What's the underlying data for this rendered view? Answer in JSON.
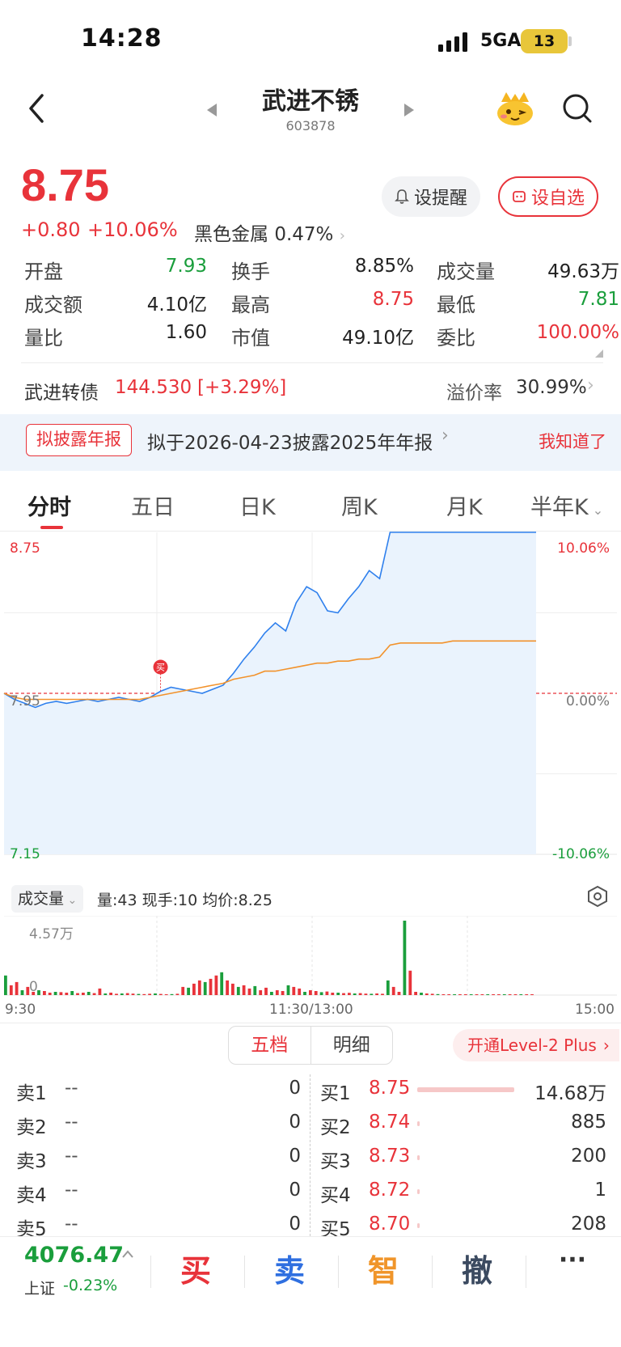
{
  "status": {
    "time": "14:28",
    "network": "5GA",
    "battery": "13"
  },
  "nav": {
    "title": "武进不锈",
    "code": "603878"
  },
  "quote": {
    "price": "8.75",
    "change": "+0.80",
    "change_pct": "+10.06%",
    "sector": "黑色金属",
    "sector_pct": "0.47%",
    "alert_label": "设提醒",
    "watch_label": "设自选"
  },
  "stats": [
    {
      "label": "开盘",
      "value": "7.93",
      "color": "green"
    },
    {
      "label": "换手",
      "value": "8.85%",
      "color": "black"
    },
    {
      "label": "成交量",
      "value": "49.63万",
      "color": "black"
    },
    {
      "label": "成交额",
      "value": "4.10亿",
      "color": "black"
    },
    {
      "label": "最高",
      "value": "8.75",
      "color": "red"
    },
    {
      "label": "最低",
      "value": "7.81",
      "color": "green"
    },
    {
      "label": "量比",
      "value": "1.60",
      "color": "black"
    },
    {
      "label": "市值",
      "value": "49.10亿",
      "color": "black"
    },
    {
      "label": "委比",
      "value": "100.00%",
      "color": "red"
    }
  ],
  "bond": {
    "label": "武进转债",
    "price": "144.530",
    "change_pct": "[+3.29%]",
    "premium_label": "溢价率",
    "premium_value": "30.99%"
  },
  "notice": {
    "tag": "拟披露年报",
    "text": "拟于2026-04-23披露2025年年报",
    "dismiss": "我知道了"
  },
  "tabs": [
    "分时",
    "五日",
    "日K",
    "周K",
    "月K",
    "半年K"
  ],
  "chart_data": {
    "type": "line",
    "y_left_ticks": [
      "8.75",
      "7.95",
      "7.15"
    ],
    "y_right_ticks": [
      "10.06%",
      "0.00%",
      "-10.06%"
    ],
    "x_ticks": [
      "9:30",
      "11:30/13:00",
      "15:00"
    ],
    "ylim": [
      7.15,
      8.75
    ],
    "buy_marker": "买",
    "series": [
      {
        "name": "price",
        "color": "#2f80ed",
        "values": [
          7.95,
          7.92,
          7.9,
          7.88,
          7.9,
          7.91,
          7.9,
          7.91,
          7.92,
          7.91,
          7.92,
          7.93,
          7.92,
          7.91,
          7.93,
          7.96,
          7.98,
          7.97,
          7.96,
          7.95,
          7.97,
          7.99,
          8.05,
          8.12,
          8.18,
          8.25,
          8.3,
          8.26,
          8.4,
          8.48,
          8.45,
          8.36,
          8.35,
          8.42,
          8.48,
          8.56,
          8.52,
          8.75,
          8.75,
          8.75,
          8.75,
          8.75,
          8.75,
          8.75,
          8.75,
          8.75,
          8.75,
          8.75,
          8.75,
          8.75,
          8.75,
          8.75
        ]
      },
      {
        "name": "avg",
        "color": "#f2922b",
        "values": [
          7.95,
          7.93,
          7.92,
          7.92,
          7.92,
          7.92,
          7.92,
          7.92,
          7.92,
          7.92,
          7.92,
          7.92,
          7.92,
          7.92,
          7.93,
          7.94,
          7.95,
          7.96,
          7.97,
          7.98,
          7.99,
          8.0,
          8.02,
          8.03,
          8.04,
          8.06,
          8.06,
          8.07,
          8.08,
          8.09,
          8.1,
          8.1,
          8.11,
          8.11,
          8.12,
          8.12,
          8.13,
          8.19,
          8.2,
          8.2,
          8.2,
          8.2,
          8.2,
          8.21,
          8.21,
          8.21,
          8.21,
          8.21,
          8.21,
          8.21,
          8.21,
          8.21
        ]
      }
    ]
  },
  "volume": {
    "dropdown": "成交量",
    "info": "量:43  现手:10  均价:8.25",
    "max_label": "4.57万",
    "zero_label": "0",
    "max": 45700,
    "bars": [
      12000,
      6000,
      8000,
      3000,
      5000,
      2000,
      3000,
      2500,
      1500,
      2000,
      1800,
      1500,
      2500,
      1200,
      1500,
      2000,
      1200,
      4000,
      1000,
      1500,
      800,
      1000,
      1200,
      900,
      700,
      600,
      800,
      1000,
      700,
      500,
      600,
      800,
      5000,
      4500,
      7000,
      9000,
      8000,
      10000,
      12000,
      14000,
      9000,
      7000,
      5000,
      6000,
      4000,
      5500,
      3000,
      4500,
      2000,
      3000,
      2500,
      6000,
      5000,
      4000,
      2000,
      3000,
      2500,
      1800,
      2200,
      1500,
      1500,
      1200,
      1400,
      1000,
      1200,
      900,
      800,
      1000,
      800,
      9000,
      5000,
      2000,
      45700,
      15000,
      2000,
      1500,
      1000,
      800,
      600,
      500,
      400,
      300,
      300,
      400,
      200,
      300,
      200,
      300,
      200,
      200,
      300,
      200,
      300,
      200,
      200,
      100
    ],
    "bar_colors": "mixed"
  },
  "orderbook": {
    "tab_active": "五档",
    "tab_other": "明细",
    "level2": "开通Level-2 Plus",
    "asks": [
      {
        "label": "卖1",
        "price": "--",
        "vol": "0"
      },
      {
        "label": "卖2",
        "price": "--",
        "vol": "0"
      },
      {
        "label": "卖3",
        "price": "--",
        "vol": "0"
      },
      {
        "label": "卖4",
        "price": "--",
        "vol": "0"
      },
      {
        "label": "卖5",
        "price": "--",
        "vol": "0"
      }
    ],
    "bids": [
      {
        "label": "买1",
        "price": "8.75",
        "vol": "14.68万",
        "bar": 1.0
      },
      {
        "label": "买2",
        "price": "8.74",
        "vol": "885",
        "bar": 0.0
      },
      {
        "label": "买3",
        "price": "8.73",
        "vol": "200",
        "bar": 0.0
      },
      {
        "label": "买4",
        "price": "8.72",
        "vol": "1",
        "bar": 0.0
      },
      {
        "label": "买5",
        "price": "8.70",
        "vol": "208",
        "bar": 0.0
      }
    ]
  },
  "bottom": {
    "index_value": "4076.47",
    "index_name": "上证",
    "index_pct": "-0.23%",
    "actions": [
      "买",
      "卖",
      "智",
      "撤"
    ],
    "more": "···"
  }
}
